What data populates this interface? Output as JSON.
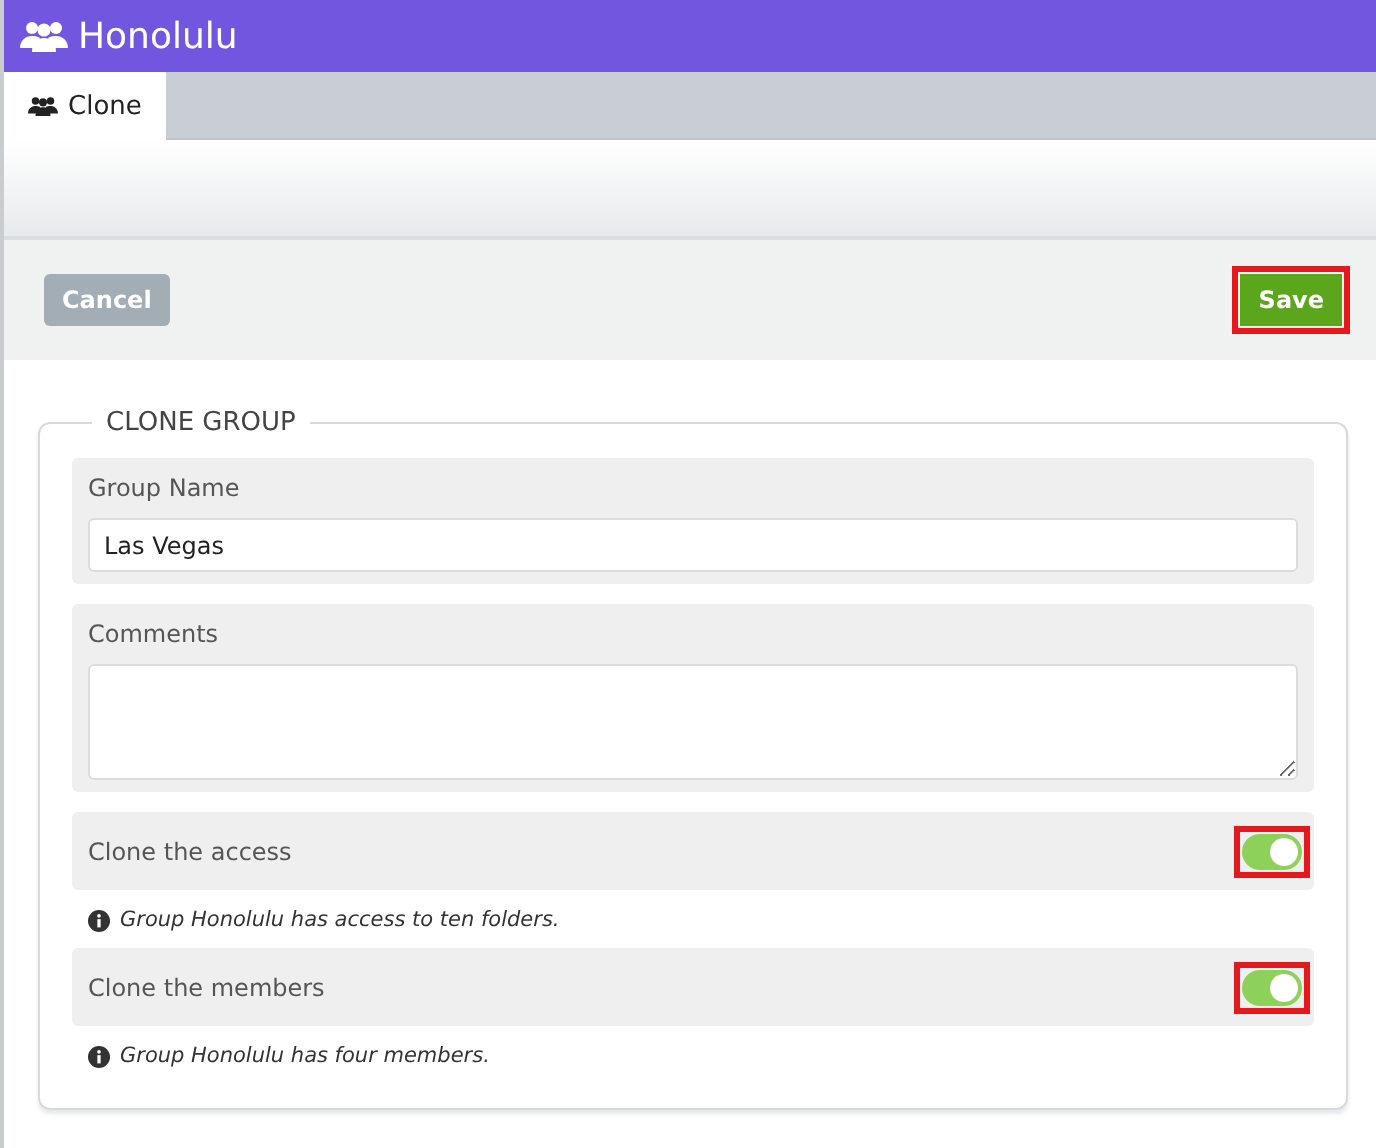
{
  "window": {
    "title": "Honolulu"
  },
  "tabs": [
    {
      "label": "Clone",
      "selected": true
    }
  ],
  "toolbar": {
    "cancel": {
      "label": "Cancel",
      "disabled": true,
      "highlighted": false
    },
    "save": {
      "label": "Save",
      "disabled": false,
      "highlighted": true
    }
  },
  "form": {
    "legend": "CLONE GROUP",
    "fields": [
      {
        "kind": "text",
        "label": "Group Name",
        "value": "Las Vegas"
      },
      {
        "kind": "textarea",
        "label": "Comments"
      }
    ],
    "toggles": [
      {
        "label": "Clone the access",
        "on": true,
        "highlighted": true,
        "note": "Group Honolulu has access to ten folders."
      },
      {
        "label": "Clone the members",
        "on": true,
        "highlighted": true,
        "note": "Group Honolulu has four members."
      }
    ]
  }
}
